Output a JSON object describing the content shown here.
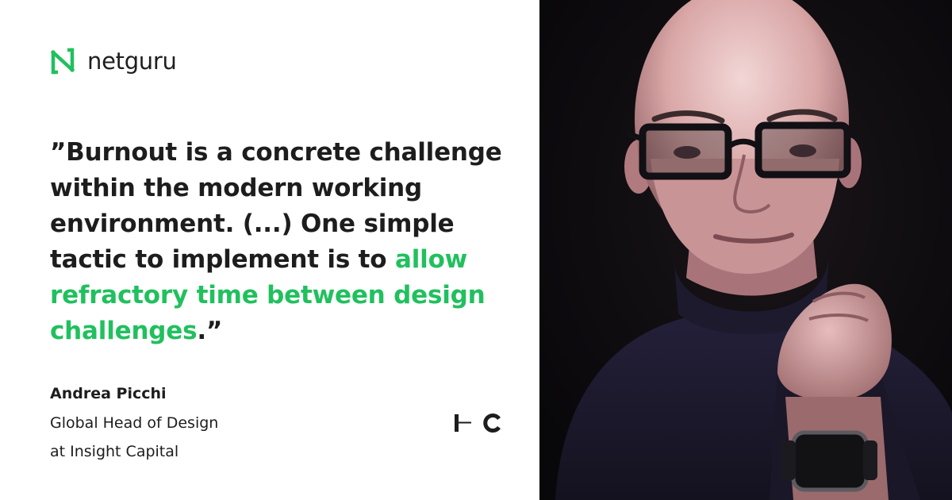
{
  "brand": {
    "name": "netguru",
    "accent_color": "#21c05e",
    "text_color": "#1d1d1d"
  },
  "quote": {
    "part1": "”Burnout is a concrete challenge within the modern working environment. (...) One simple tactic to implement is to ",
    "highlight": "allow refractory time between design challenges",
    "part2": ".”"
  },
  "author": {
    "name": "Andrea Picchi",
    "role_line1": "Global Head of Design",
    "role_line2": "at Insight Capital"
  },
  "company_logo": {
    "icon": "insight-capital-logo"
  },
  "photo": {
    "icon": "portrait-photo"
  }
}
